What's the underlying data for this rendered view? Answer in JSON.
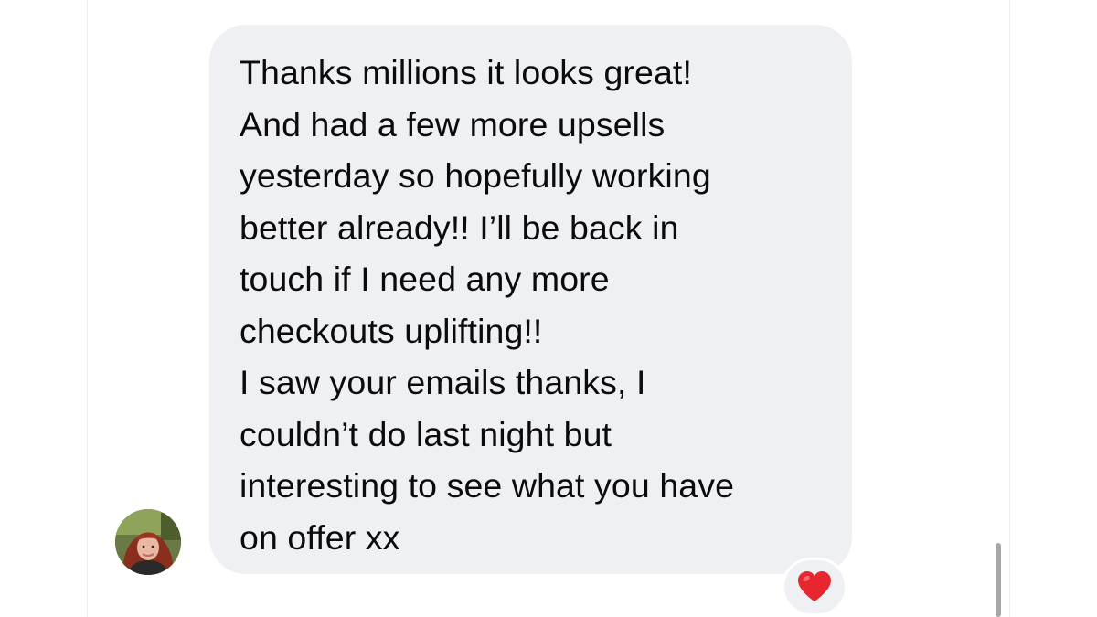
{
  "message": {
    "sender_avatar": "user-avatar-photo",
    "lines": [
      "Thanks millions it looks great!",
      "And had a few more upsells",
      "yesterday so hopefully working",
      "better already!! I’ll be back in",
      "touch if I need any more",
      "checkouts uplifting!!",
      "I saw your emails thanks, I",
      "couldn’t do last night but",
      "interesting to see what you have",
      "on offer xx"
    ],
    "reaction": {
      "icon": "heart-icon",
      "color": "#e8262f"
    }
  },
  "colors": {
    "bubble": "#eff0f4",
    "text": "#0b0b0b",
    "background": "#ffffff"
  }
}
